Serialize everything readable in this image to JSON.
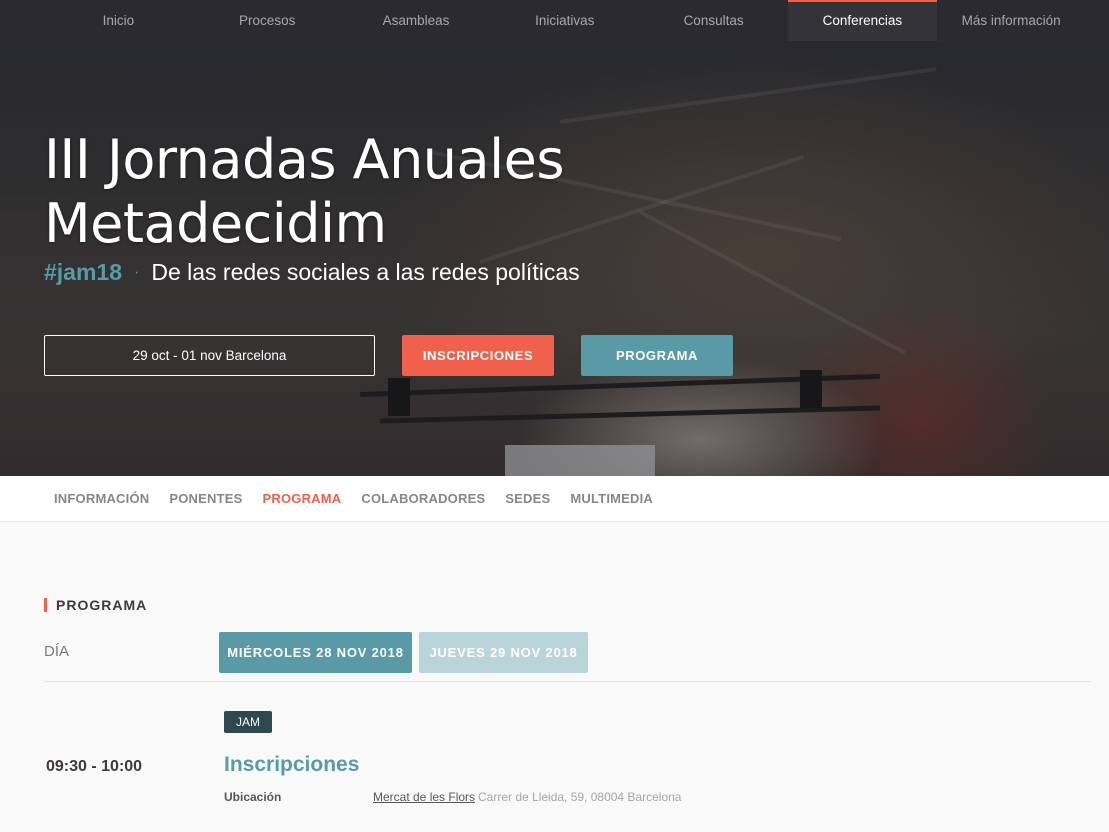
{
  "topnav": {
    "items": [
      {
        "label": "Inicio"
      },
      {
        "label": "Procesos"
      },
      {
        "label": "Asambleas"
      },
      {
        "label": "Iniciativas"
      },
      {
        "label": "Consultas"
      },
      {
        "label": "Conferencias",
        "active": true
      },
      {
        "label": "Más información"
      }
    ]
  },
  "hero": {
    "title_line1": "III Jornadas Anuales",
    "title_line2": "Metadecidim",
    "hashtag": "#jam18",
    "separator": "·",
    "subtitle": "De las redes sociales a las redes políticas",
    "date_location": "29 oct - 01 nov Barcelona",
    "register_button": "INSCRIPCIONES",
    "program_button": "PROGRAMA"
  },
  "subnav": {
    "items": [
      {
        "label": "INFORMACIÓN"
      },
      {
        "label": "PONENTES"
      },
      {
        "label": "PROGRAMA",
        "active": true
      },
      {
        "label": "COLABORADORES"
      },
      {
        "label": "SEDES"
      },
      {
        "label": "MULTIMEDIA"
      }
    ]
  },
  "program": {
    "section_title": "PROGRAMA",
    "day_label": "DÍA",
    "days": [
      {
        "label": "MIÉRCOLES 28 NOV 2018",
        "active": true
      },
      {
        "label": "JUEVES 29 NOV 2018",
        "active": false
      }
    ],
    "event": {
      "tag": "JAM",
      "time": "09:30 - 10:00",
      "title": "Inscripciones",
      "location_label": "Ubicación",
      "location_name": "Mercat de les Flors",
      "location_address": "Carrer de Lleida, 59, 08004 Barcelona"
    }
  },
  "colors": {
    "accent_red": "#ef604d",
    "accent_teal": "#599aa6",
    "nav_bg": "#2b2a2e",
    "tag_bg": "#2f4751"
  }
}
